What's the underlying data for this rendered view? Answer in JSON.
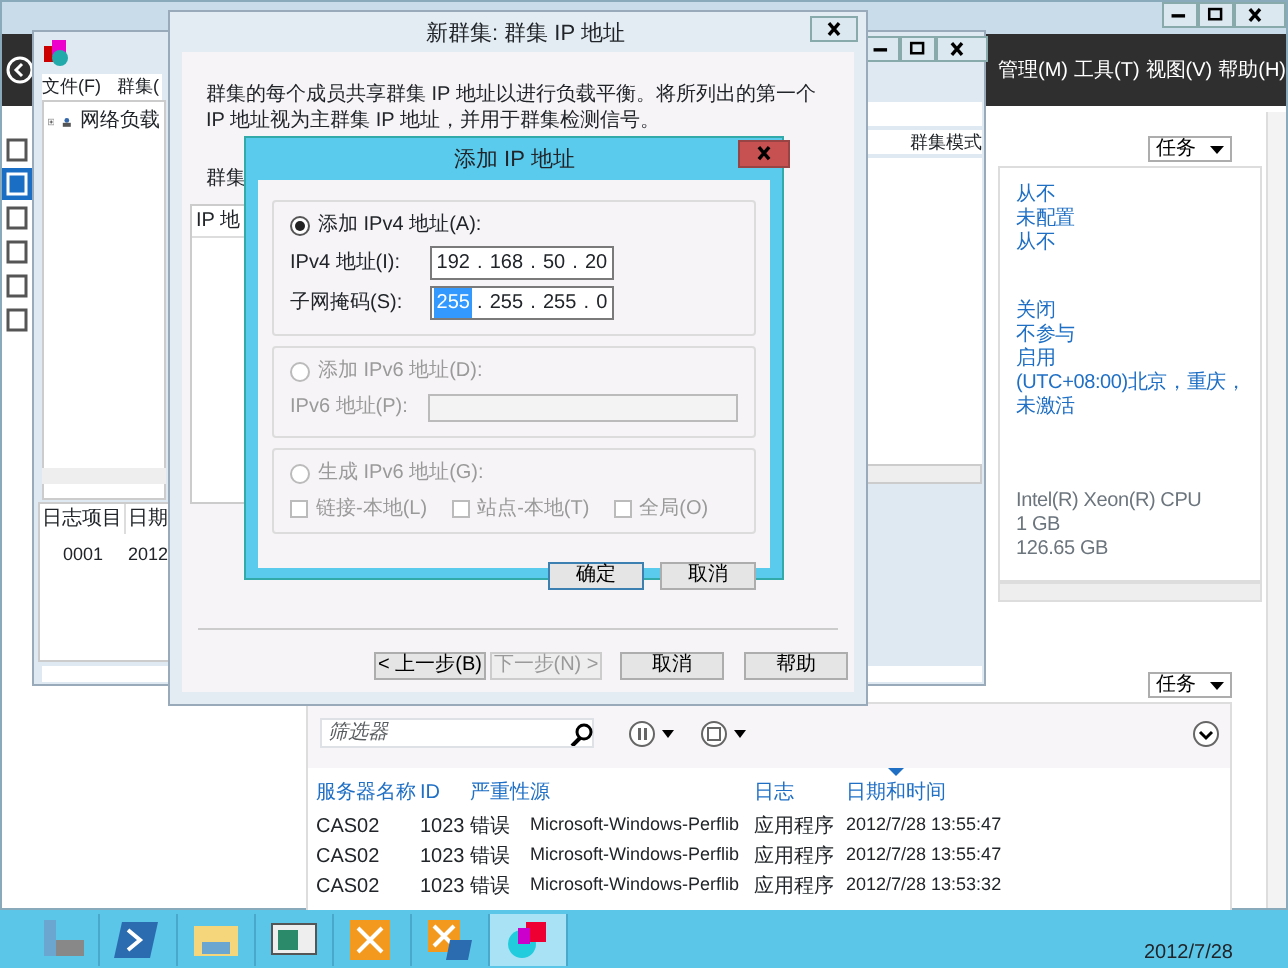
{
  "server_manager": {
    "menu": [
      "管理(M)",
      "工具(T)",
      "视图(V)",
      "帮助(H)"
    ],
    "sidebar": [
      {
        "selected": false
      },
      {
        "selected": true
      },
      {
        "selected": false
      },
      {
        "selected": false
      },
      {
        "selected": false
      },
      {
        "selected": false
      }
    ],
    "properties": {
      "task_button": "任务",
      "groups": [
        [
          "从不",
          "未配置",
          "从不"
        ],
        [
          "关闭",
          "不参与",
          "启用",
          "(UTC+08:00)北京，重庆，",
          "未激活"
        ],
        [
          "Intel(R) Xeon(R) CPU",
          "1 GB",
          "126.65 GB"
        ]
      ]
    },
    "events": {
      "task_button": "任务",
      "filter_placeholder": "筛选器",
      "columns": [
        {
          "label": "服务器名称",
          "sorted": false
        },
        {
          "label": "ID",
          "sorted": false
        },
        {
          "label": "严重性",
          "sorted": false
        },
        {
          "label": "源",
          "sorted": false
        },
        {
          "label": "日志",
          "sorted": false
        },
        {
          "label": "日期和时间",
          "sorted": true
        }
      ],
      "rows": [
        [
          "CAS02",
          "1023",
          "错误",
          "Microsoft-Windows-Perflib",
          "应用程序",
          "2012/7/28 13:55:47"
        ],
        [
          "CAS02",
          "1023",
          "错误",
          "Microsoft-Windows-Perflib",
          "应用程序",
          "2012/7/28 13:55:47"
        ],
        [
          "CAS02",
          "1023",
          "错误",
          "Microsoft-Windows-Perflib",
          "应用程序",
          "2012/7/28 13:53:32"
        ]
      ]
    }
  },
  "nlb_manager": {
    "menu": [
      "文件(F)",
      "群集("
    ],
    "tree": [
      {
        "label": "网络负载",
        "expanded": false
      }
    ],
    "column": "群集模式",
    "log_columns": [
      "日志项目",
      "日期"
    ],
    "log_rows": [
      [
        "0001",
        "2012"
      ]
    ]
  },
  "wizard": {
    "title": "新群集: 群集 IP 地址",
    "description": "群集的每个成员共享群集 IP 地址以进行负载平衡。将所列出的第一个 IP 地址视为主群集 IP 地址，并用于群集检测信号。",
    "list_label": "群集",
    "list_header": "IP 地",
    "buttons": [
      {
        "label": "< 上一步(B)",
        "disabled": false
      },
      {
        "label": "下一步(N) >",
        "disabled": true
      },
      {
        "label": "取消",
        "disabled": false
      },
      {
        "label": "帮助",
        "disabled": false
      }
    ]
  },
  "dialog": {
    "title": "添加 IP 地址",
    "separator": ".",
    "options": [
      {
        "kind": "ipv4",
        "label": "添加 IPv4 地址(A):",
        "selected": true,
        "disabled": false,
        "fields": [
          {
            "label": "IPv4 地址(I):",
            "octets": [
              {
                "text": "192",
                "selected": false
              },
              {
                "text": "168",
                "selected": false
              },
              {
                "text": "50",
                "selected": false
              },
              {
                "text": "20",
                "selected": false
              }
            ]
          },
          {
            "label": "子网掩码(S):",
            "octets": [
              {
                "text": "255",
                "selected": true
              },
              {
                "text": "255",
                "selected": false
              },
              {
                "text": "255",
                "selected": false
              },
              {
                "text": "0",
                "selected": false
              }
            ]
          }
        ]
      },
      {
        "kind": "ipv6",
        "label": "添加 IPv6 地址(D):",
        "selected": false,
        "disabled": true,
        "fields": [
          {
            "label": "IPv6 地址(P):"
          }
        ]
      },
      {
        "kind": "generate",
        "label": "生成 IPv6 地址(G):",
        "selected": false,
        "disabled": true,
        "checkboxes": [
          {
            "label": "链接-本地(L)",
            "checked": false
          },
          {
            "label": "站点-本地(T)",
            "checked": false
          },
          {
            "label": "全局(O)",
            "checked": false
          }
        ]
      }
    ],
    "buttons": [
      "确定",
      "取消"
    ]
  },
  "taskbar": {
    "apps": [
      {
        "kind": "server",
        "selected": false
      },
      {
        "kind": "shell",
        "selected": false
      },
      {
        "kind": "folder",
        "selected": false
      },
      {
        "kind": "monitor",
        "selected": false
      },
      {
        "kind": "exchange",
        "selected": false
      },
      {
        "kind": "exchange-shell",
        "selected": false
      },
      {
        "kind": "cluster",
        "selected": true
      }
    ],
    "date": "2012/7/28"
  }
}
